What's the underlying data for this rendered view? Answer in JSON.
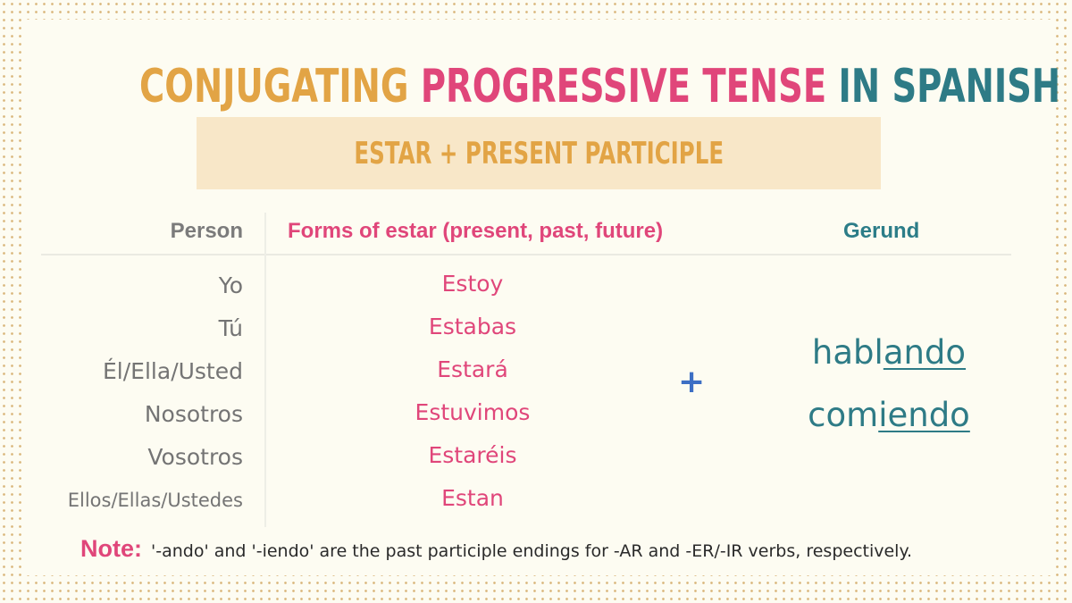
{
  "title": {
    "part1": "CONJUGATING ",
    "part2": "PROGRESSIVE TENSE ",
    "part3": "IN SPANISH",
    "colors": {
      "part1": "#e2a445",
      "part2": "#e0467a",
      "part3": "#2e7b86"
    }
  },
  "banner": {
    "text": "ESTAR + PRESENT PARTICIPLE"
  },
  "table": {
    "headers": {
      "person": "Person",
      "forms": "Forms of estar (present, past, future)",
      "gerund": "Gerund"
    },
    "rows": [
      {
        "person": "Yo",
        "form": "Estoy"
      },
      {
        "person": "Tú",
        "form": "Estabas"
      },
      {
        "person": "Él/Ella/Usted",
        "form": "Estará"
      },
      {
        "person": "Nosotros",
        "form": "Estuvimos"
      },
      {
        "person": "Vosotros",
        "form": "Estaréis"
      },
      {
        "person": "Ellos/Ellas/Ustedes",
        "form": "Estan"
      }
    ],
    "operator": "+",
    "gerunds": [
      {
        "stem": "habl",
        "ending": "ando"
      },
      {
        "stem": "com",
        "ending": "iendo"
      }
    ]
  },
  "note": {
    "label": "Note:",
    "text": "'-ando' and '-iendo' are the past participle endings for -AR and -ER/-IR verbs, respectively."
  }
}
